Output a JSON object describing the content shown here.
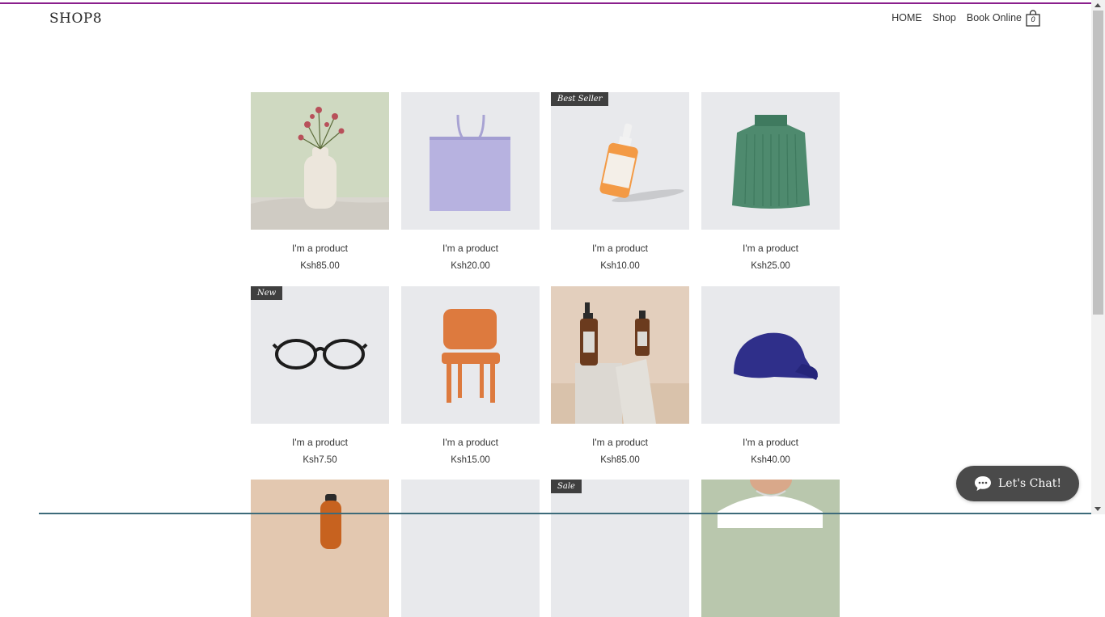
{
  "header": {
    "logo": "SHOP8",
    "nav": [
      "HOME",
      "Shop",
      "Book Online"
    ],
    "cart_count": "0",
    "accent_color": "#8a1f8c"
  },
  "products": [
    {
      "name": "I'm a product",
      "price": "Ksh85.00",
      "ribbon": "",
      "image": "flower-vase"
    },
    {
      "name": "I'm a product",
      "price": "Ksh20.00",
      "ribbon": "",
      "image": "tote-bag"
    },
    {
      "name": "I'm a product",
      "price": "Ksh10.00",
      "ribbon": "Best Seller",
      "image": "serum-bottle"
    },
    {
      "name": "I'm a product",
      "price": "Ksh25.00",
      "ribbon": "",
      "image": "green-sweater"
    },
    {
      "name": "I'm a product",
      "price": "Ksh7.50",
      "ribbon": "New",
      "image": "eyeglasses"
    },
    {
      "name": "I'm a product",
      "price": "Ksh15.00",
      "ribbon": "",
      "image": "wooden-chair"
    },
    {
      "name": "I'm a product",
      "price": "Ksh85.00",
      "ribbon": "",
      "image": "amber-bottles"
    },
    {
      "name": "I'm a product",
      "price": "Ksh40.00",
      "ribbon": "",
      "image": "blue-cap"
    },
    {
      "name": "",
      "price": "",
      "ribbon": "",
      "image": "orange-bottle"
    },
    {
      "name": "",
      "price": "",
      "ribbon": "",
      "image": "blank"
    },
    {
      "name": "",
      "price": "",
      "ribbon": "Sale",
      "image": "blank"
    },
    {
      "name": "",
      "price": "",
      "ribbon": "",
      "image": "white-tshirt"
    }
  ],
  "chat": {
    "label": "Let's Chat!"
  }
}
